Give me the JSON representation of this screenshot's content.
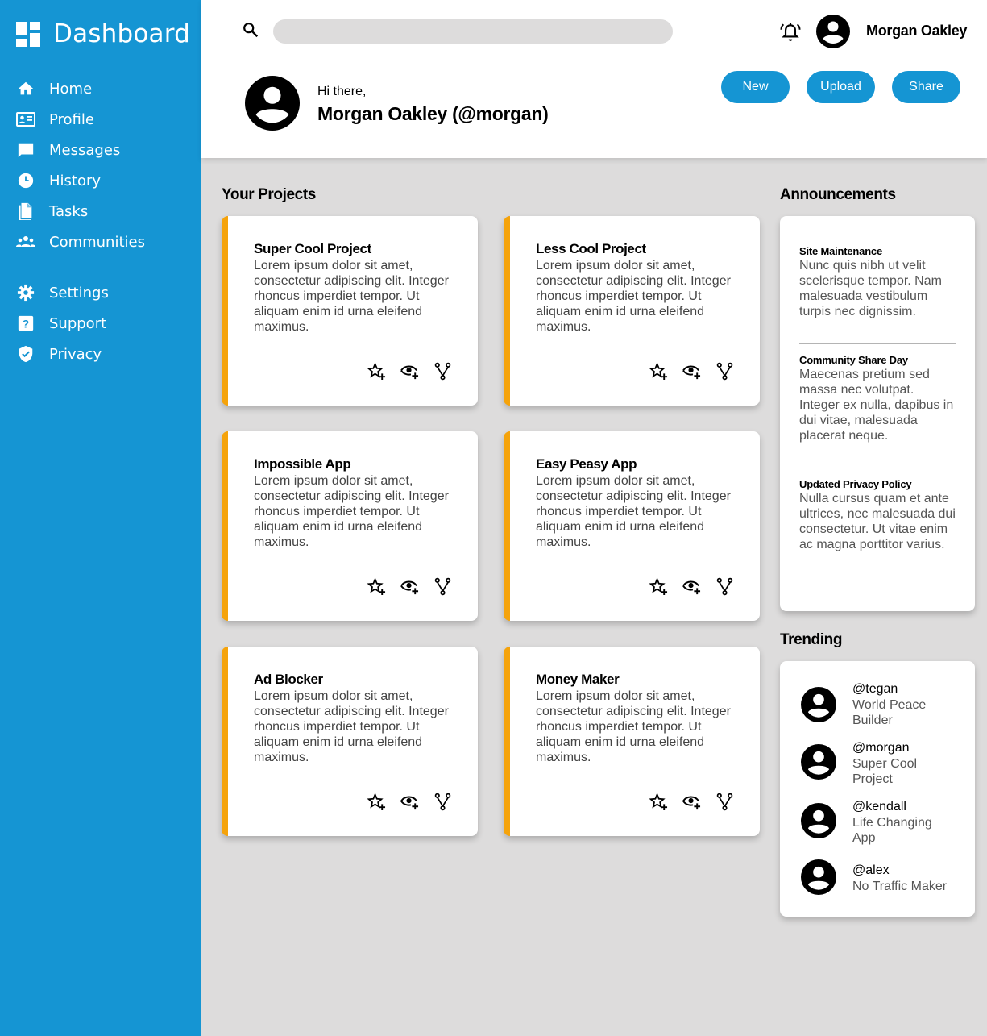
{
  "brand": {
    "title": "Dashboard"
  },
  "sidebar": {
    "items": [
      {
        "label": "Home",
        "icon": "home-icon"
      },
      {
        "label": "Profile",
        "icon": "id-card-icon"
      },
      {
        "label": "Messages",
        "icon": "chat-icon"
      },
      {
        "label": "History",
        "icon": "clock-icon"
      },
      {
        "label": "Tasks",
        "icon": "file-icon"
      },
      {
        "label": "Communities",
        "icon": "group-icon"
      }
    ],
    "secondary": [
      {
        "label": "Settings",
        "icon": "gear-icon"
      },
      {
        "label": "Support",
        "icon": "help-icon"
      },
      {
        "label": "Privacy",
        "icon": "shield-icon"
      }
    ]
  },
  "header": {
    "search_placeholder": "",
    "user_name": "Morgan Oakley",
    "greeting": "Hi there,",
    "full_name": "Morgan Oakley (@morgan)",
    "buttons": {
      "new": "New",
      "upload": "Upload",
      "share": "Share"
    }
  },
  "projects": {
    "title": "Your Projects",
    "items": [
      {
        "title": "Super Cool Project",
        "desc": "Lorem ipsum dolor sit amet, consectetur adipiscing elit. Integer rhoncus imperdiet tempor. Ut aliquam enim id urna eleifend maximus."
      },
      {
        "title": "Less Cool Project",
        "desc": "Lorem ipsum dolor sit amet, consectetur adipiscing elit. Integer rhoncus imperdiet tempor. Ut aliquam enim id urna eleifend maximus."
      },
      {
        "title": "Impossible App",
        "desc": "Lorem ipsum dolor sit amet, consectetur adipiscing elit. Integer rhoncus imperdiet tempor. Ut aliquam enim id urna eleifend maximus."
      },
      {
        "title": "Easy Peasy App",
        "desc": "Lorem ipsum dolor sit amet, consectetur adipiscing elit. Integer rhoncus imperdiet tempor. Ut aliquam enim id urna eleifend maximus."
      },
      {
        "title": "Ad Blocker",
        "desc": "Lorem ipsum dolor sit amet, consectetur adipiscing elit. Integer rhoncus imperdiet tempor. Ut aliquam enim id urna eleifend maximus."
      },
      {
        "title": "Money Maker",
        "desc": "Lorem ipsum dolor sit amet, consectetur adipiscing elit. Integer rhoncus imperdiet tempor. Ut aliquam enim id urna eleifend maximus."
      }
    ]
  },
  "announcements": {
    "title": "Announcements",
    "items": [
      {
        "title": "Site Maintenance",
        "body": "Nunc quis nibh ut velit scelerisque tempor. Nam malesuada vestibulum turpis nec dignissim."
      },
      {
        "title": "Community Share Day",
        "body": "Maecenas pretium sed massa nec volutpat. Integer ex nulla, dapibus in dui vitae, malesuada placerat neque."
      },
      {
        "title": "Updated Privacy Policy",
        "body": "Nulla cursus quam et ante ultrices, nec malesuada dui consectetur. Ut vitae enim ac magna porttitor varius."
      }
    ]
  },
  "trending": {
    "title": "Trending",
    "items": [
      {
        "handle": "@tegan",
        "project": "World Peace Builder"
      },
      {
        "handle": "@morgan",
        "project": "Super Cool Project"
      },
      {
        "handle": "@kendall",
        "project": "Life Changing App"
      },
      {
        "handle": "@alex",
        "project": "No Traffic Maker"
      }
    ]
  },
  "colors": {
    "accent": "#1595d3",
    "card_stripe": "#f5a30b",
    "background": "#dddcdc"
  }
}
